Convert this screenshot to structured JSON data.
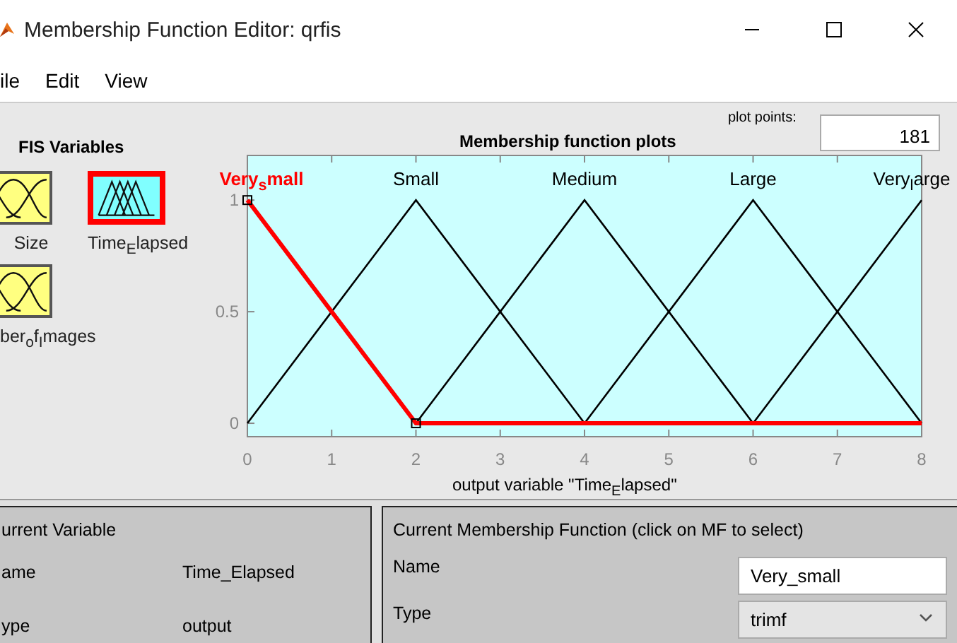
{
  "window": {
    "title": "Membership Function Editor: qrfis"
  },
  "menu": [
    "ile",
    "Edit",
    "View"
  ],
  "fis_variables": {
    "title": "FIS Variables",
    "items": [
      {
        "label": "Size",
        "kind": "input",
        "selected": false
      },
      {
        "label": "Time$_{E}$lapsed",
        "kind": "output",
        "selected": true
      },
      {
        "label": "ber$_{o}$f$_{I}$mages",
        "kind": "input",
        "selected": false
      }
    ]
  },
  "plot": {
    "title": "Membership function plots",
    "plot_points_label": "plot points:",
    "plot_points": "181",
    "chart_data": {
      "type": "line",
      "xlabel": "output variable \"Time$_{E}$lapsed\"",
      "x": [
        0,
        1,
        2,
        3,
        4,
        5,
        6,
        7,
        8
      ],
      "series": [
        {
          "name": "Very$_{s}$mall",
          "values": [
            1,
            0.5,
            0,
            0,
            0,
            0,
            0,
            0,
            0
          ]
        },
        {
          "name": "Small",
          "values": [
            0,
            0.5,
            1,
            0.5,
            0,
            null,
            null,
            null,
            null
          ]
        },
        {
          "name": "Medium",
          "values": [
            null,
            null,
            0,
            0.5,
            1,
            0.5,
            0,
            null,
            null
          ]
        },
        {
          "name": "Large",
          "values": [
            null,
            null,
            null,
            null,
            0,
            0.5,
            1,
            0.5,
            0
          ]
        },
        {
          "name": "Very$_{l}$arge",
          "values": [
            null,
            null,
            null,
            null,
            null,
            null,
            0,
            0.5,
            1
          ]
        }
      ],
      "xlim": [
        0,
        8
      ],
      "ylim": [
        -0.06,
        1.2
      ],
      "xticks": [
        0,
        1,
        2,
        3,
        4,
        5,
        6,
        7,
        8
      ],
      "yticks": [
        0,
        0.5,
        1
      ]
    },
    "membership_functions": [
      {
        "selected": true
      },
      {
        "selected": false
      },
      {
        "selected": false
      },
      {
        "selected": false
      },
      {
        "selected": false
      }
    ]
  },
  "current_variable": {
    "title": "urrent Variable",
    "rows": [
      {
        "label": "ame",
        "value": "Time_Elapsed"
      },
      {
        "label": "ype",
        "value": "output"
      }
    ]
  },
  "current_mf": {
    "title": "Current Membership Function (click on MF to select)",
    "fields": [
      {
        "label": "Name",
        "kind": "text",
        "value": "Very_small"
      },
      {
        "label": "Type",
        "kind": "select",
        "value": "trimf"
      }
    ]
  }
}
